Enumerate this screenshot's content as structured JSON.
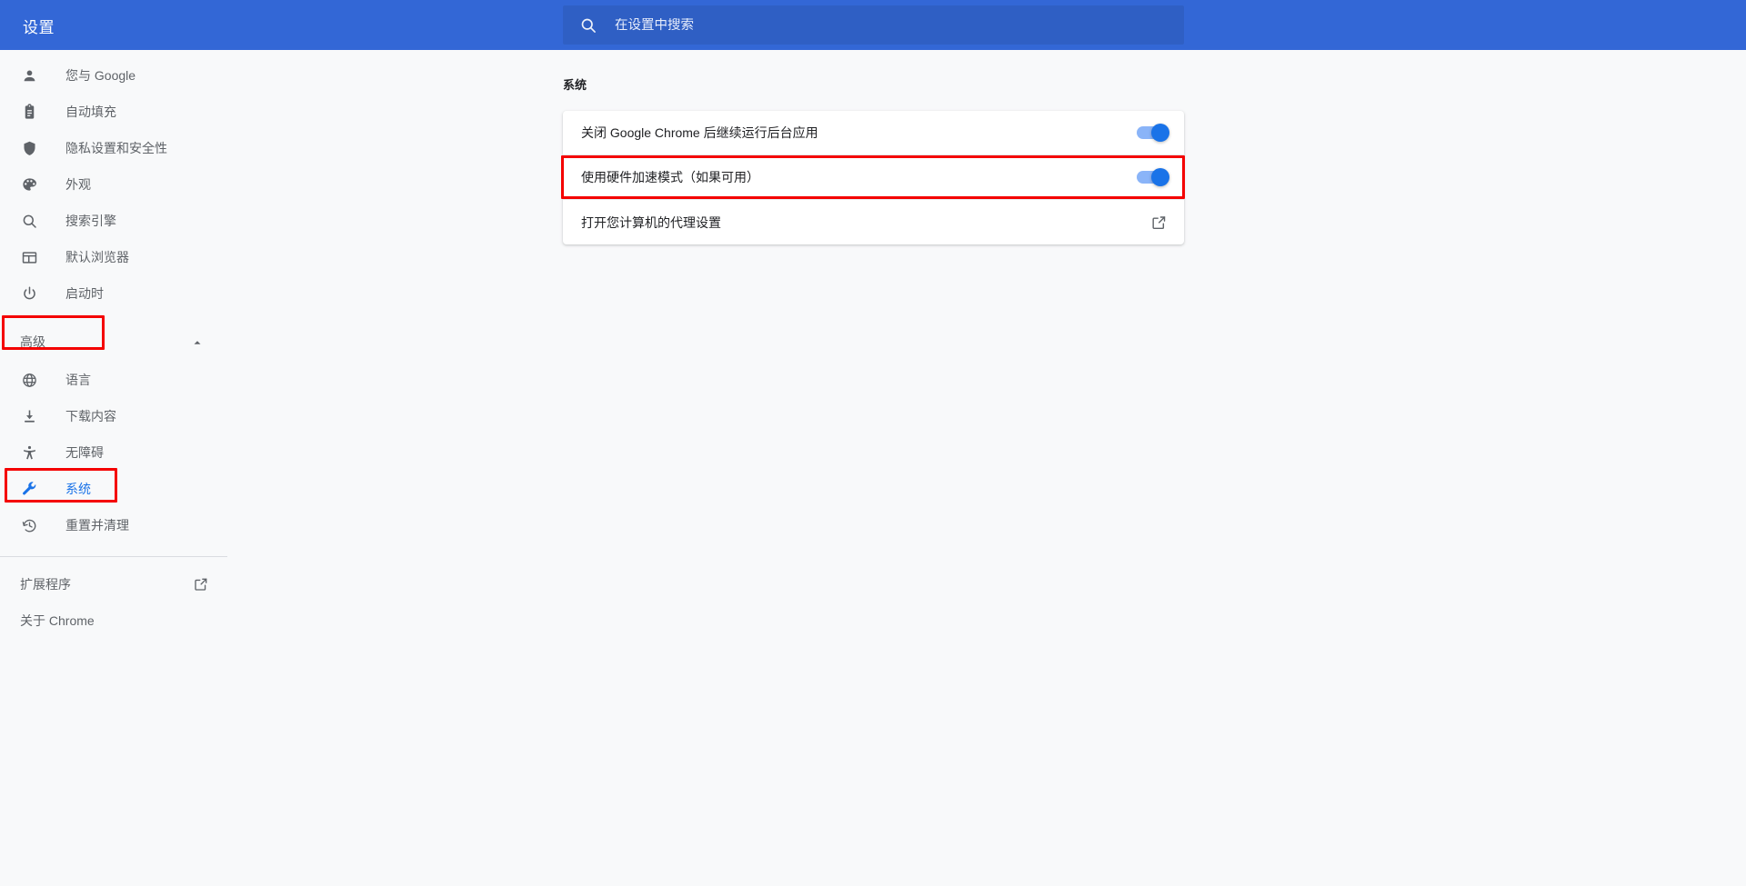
{
  "header": {
    "title": "设置",
    "search": {
      "placeholder": "在设置中搜索",
      "value": "",
      "icon": "search-icon"
    },
    "background_color": "#3367d6",
    "search_background_color": "#2f5fc4"
  },
  "sidebar": {
    "items": [
      {
        "label": "您与 Google",
        "icon": "person-icon",
        "active": false
      },
      {
        "label": "自动填充",
        "icon": "clipboard-icon",
        "active": false
      },
      {
        "label": "隐私设置和安全性",
        "icon": "shield-icon",
        "active": false
      },
      {
        "label": "外观",
        "icon": "palette-icon",
        "active": false
      },
      {
        "label": "搜索引擎",
        "icon": "search-icon",
        "active": false
      },
      {
        "label": "默认浏览器",
        "icon": "browser-window-icon",
        "active": false
      },
      {
        "label": "启动时",
        "icon": "power-icon",
        "active": false
      }
    ],
    "advanced_group": {
      "label": "高级",
      "expanded": true,
      "chevron_icon": "chevron-up-icon"
    },
    "advanced_items": [
      {
        "label": "语言",
        "icon": "globe-icon",
        "active": false
      },
      {
        "label": "下载内容",
        "icon": "download-icon",
        "active": false
      },
      {
        "label": "无障碍",
        "icon": "accessibility-icon",
        "active": false
      },
      {
        "label": "系统",
        "icon": "wrench-icon",
        "active": true
      },
      {
        "label": "重置并清理",
        "icon": "history-restore-icon",
        "active": false
      }
    ],
    "footer_items": [
      {
        "label": "扩展程序",
        "external": true,
        "external_icon": "external-link-icon"
      },
      {
        "label": "关于 Chrome",
        "external": false
      }
    ],
    "active_color": "#1a73e8",
    "text_color": "#5f6368"
  },
  "main": {
    "section_title": "系统",
    "rows": [
      {
        "label": "关闭 Google Chrome 后继续运行后台应用",
        "control": "toggle",
        "toggle_on": true
      },
      {
        "label": "使用硬件加速模式（如果可用）",
        "control": "toggle",
        "toggle_on": true
      },
      {
        "label": "打开您计算机的代理设置",
        "control": "external-link",
        "control_icon": "external-link-icon"
      }
    ]
  },
  "annotations": {
    "color": "#f40000",
    "boxes": [
      {
        "name": "advanced-nav-highlight",
        "target": "高级"
      },
      {
        "name": "system-nav-highlight",
        "target": "系统"
      },
      {
        "name": "hardware-acceleration-row-highlight",
        "target": "使用硬件加速模式（如果可用）"
      }
    ]
  }
}
